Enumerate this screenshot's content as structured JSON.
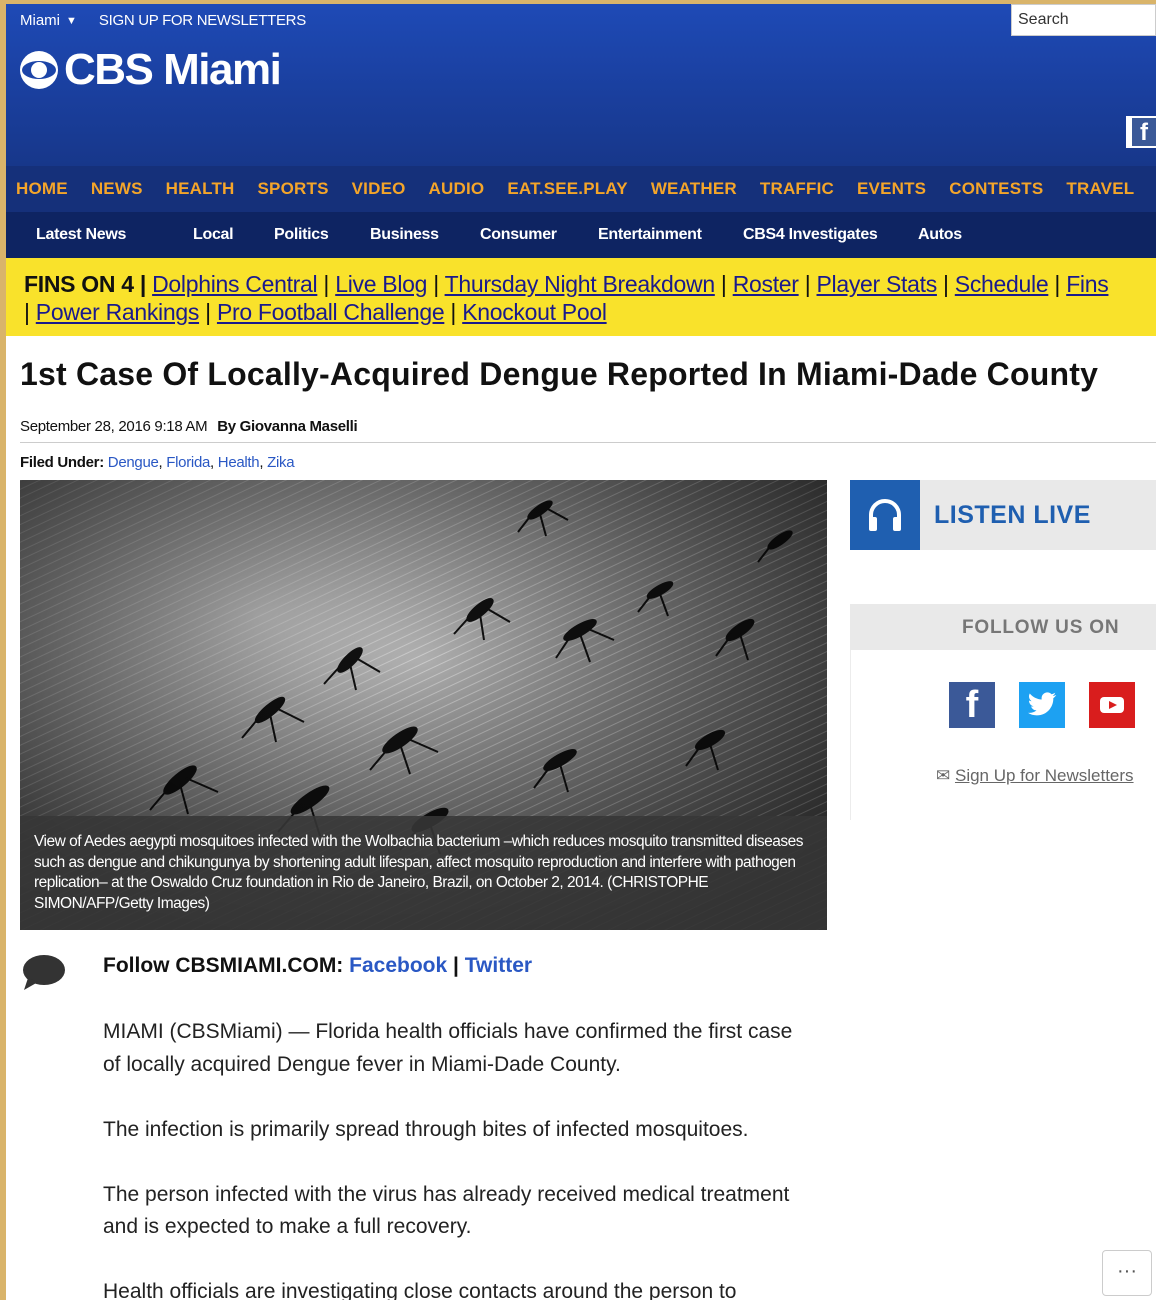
{
  "header": {
    "city": "Miami",
    "newsletter_link": "SIGN UP FOR NEWSLETTERS",
    "logo_text": "CBS Miami",
    "search_placeholder": "Search",
    "corner_facebook": "f"
  },
  "nav_primary": [
    "HOME",
    "NEWS",
    "HEALTH",
    "SPORTS",
    "VIDEO",
    "AUDIO",
    "EAT.SEE.PLAY",
    "WEATHER",
    "TRAFFIC",
    "EVENTS",
    "CONTESTS",
    "TRAVEL"
  ],
  "nav_secondary": [
    "Latest News",
    "Local",
    "Politics",
    "Business",
    "Consumer",
    "Entertainment",
    "CBS4 Investigates",
    "Autos"
  ],
  "promo": {
    "lead": "FINS ON 4 |",
    "links_line1": [
      "Dolphins Central",
      "Live Blog",
      "Thursday Night Breakdown",
      "Roster",
      "Player Stats",
      "Schedule",
      "Fins"
    ],
    "links_line2": [
      "Power Rankings",
      "Pro Football Challenge",
      "Knockout Pool"
    ]
  },
  "article": {
    "headline": "1st Case Of Locally-Acquired Dengue Reported In Miami-Dade County",
    "date": "September 28, 2016 9:18 AM",
    "author": "By Giovanna Maselli",
    "filed_label": "Filed Under:",
    "tags": [
      "Dengue",
      "Florida",
      "Health",
      "Zika"
    ],
    "caption": "View of Aedes aegypti mosquitoes infected with the Wolbachia bacterium –which reduces mosquito transmitted diseases such as dengue and chikungunya by shortening adult lifespan, affect mosquito reproduction and interfere with pathogen replication– at the Oswaldo Cruz foundation in Rio de Janeiro, Brazil, on October 2, 2014. (CHRISTOPHE SIMON/AFP/Getty Images)",
    "follow_label": "Follow CBSMIAMI.COM:",
    "follow_facebook": "Facebook",
    "follow_sep": "|",
    "follow_twitter": "Twitter",
    "paragraphs": [
      "MIAMI (CBSMiami) — Florida health officials have confirmed the first case of locally acquired Dengue fever in Miami-Dade County.",
      "The infection is primarily spread through bites of infected mosquitoes.",
      "The person infected with the virus has already received medical treatment and is expected to make a full recovery.",
      "Health officials are investigating close contacts around the person to"
    ]
  },
  "sidebar": {
    "listen_live": "LISTEN LIVE",
    "follow_us": "FOLLOW US ON",
    "newsletter_link": "Sign Up for Newsletters"
  },
  "more_button": "···",
  "colors": {
    "header_blue": "#1c44a8",
    "nav_orange": "#f4a52a",
    "promo_yellow": "#f9e22b",
    "link_blue": "#2a58c4",
    "listen_blue": "#1f5fb0"
  }
}
